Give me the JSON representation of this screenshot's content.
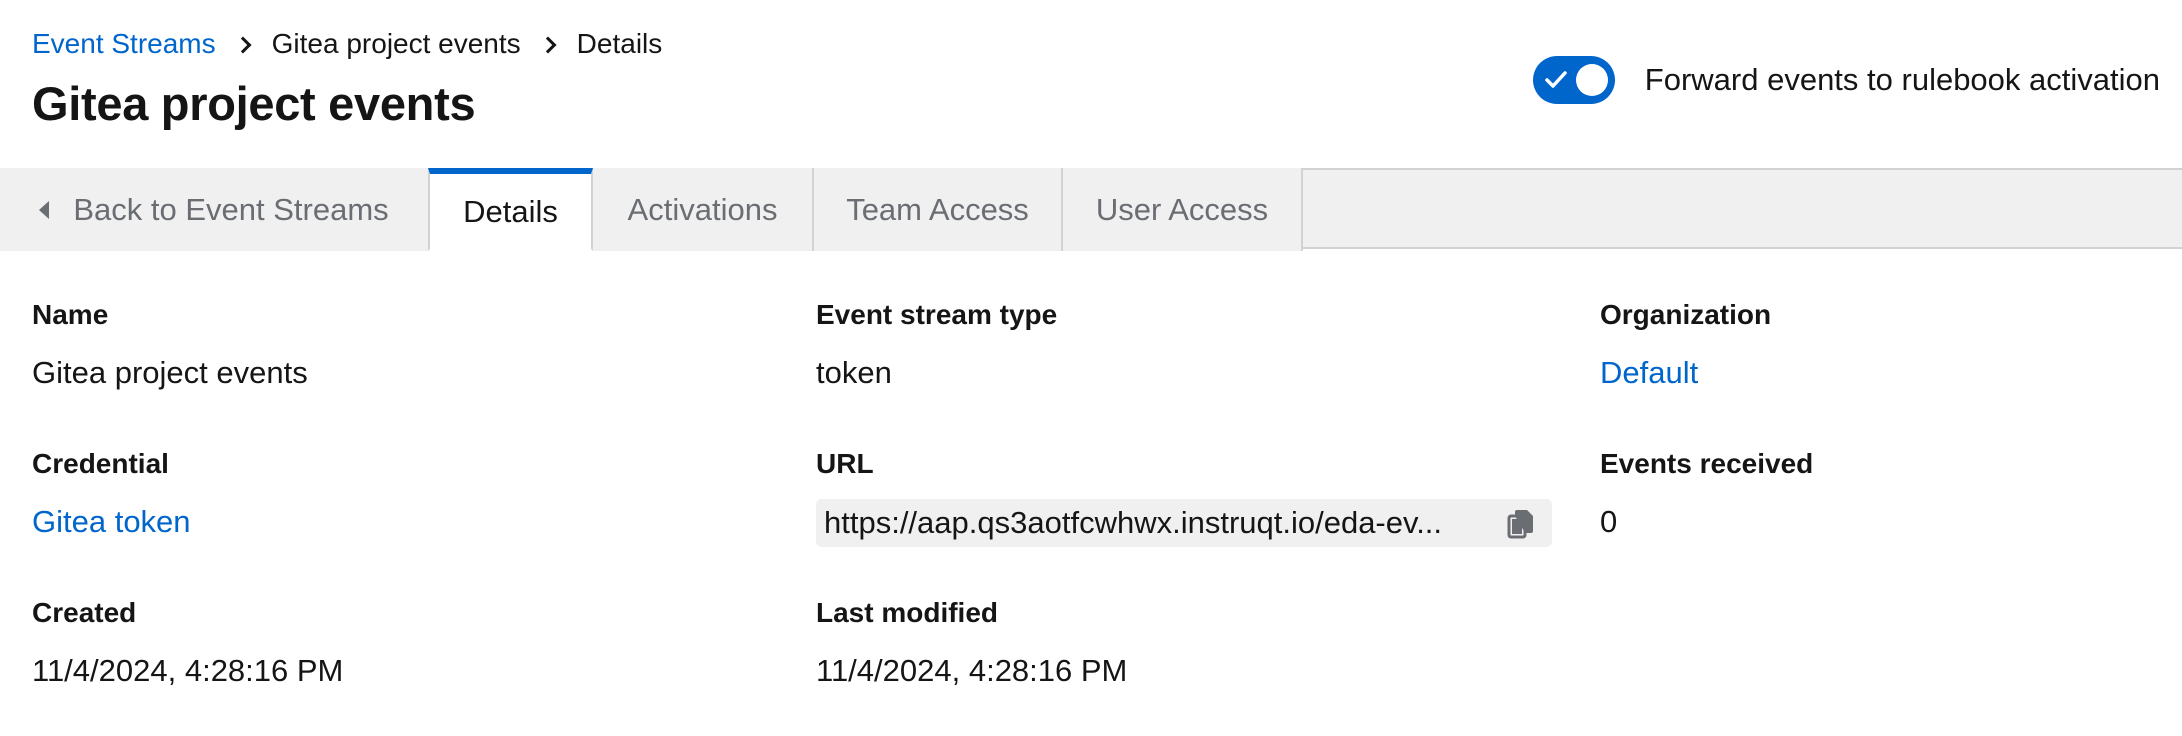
{
  "breadcrumb": {
    "items": [
      "Event Streams",
      "Gitea project events",
      "Details"
    ]
  },
  "page": {
    "title": "Gitea project events"
  },
  "forward_toggle": {
    "label": "Forward events to rulebook activation",
    "checked": true
  },
  "tabs": {
    "back": "Back to Event Streams",
    "items": [
      "Details",
      "Activations",
      "Team Access",
      "User Access"
    ],
    "active": "Details"
  },
  "details": {
    "name": {
      "label": "Name",
      "value": "Gitea project events"
    },
    "event_stream_type": {
      "label": "Event stream type",
      "value": "token"
    },
    "organization": {
      "label": "Organization",
      "value": "Default"
    },
    "credential": {
      "label": "Credential",
      "value": "Gitea token"
    },
    "url": {
      "label": "URL",
      "value": "https://aap.qs3aotfcwhwx.instruqt.io/eda-ev..."
    },
    "events_received": {
      "label": "Events received",
      "value": "0"
    },
    "created": {
      "label": "Created",
      "value": "11/4/2024, 4:28:16 PM"
    },
    "last_modified": {
      "label": "Last modified",
      "value": "11/4/2024, 4:28:16 PM"
    }
  },
  "icons": {
    "breadcrumb_separator": "chevron-right-icon",
    "back": "caret-left-icon",
    "copy": "copy-icon",
    "toggle_check": "check-icon"
  },
  "colors": {
    "accent": "#0066cc",
    "tab_bar": "#f0f0f0",
    "text": "#151515",
    "muted": "#6a6e73"
  }
}
